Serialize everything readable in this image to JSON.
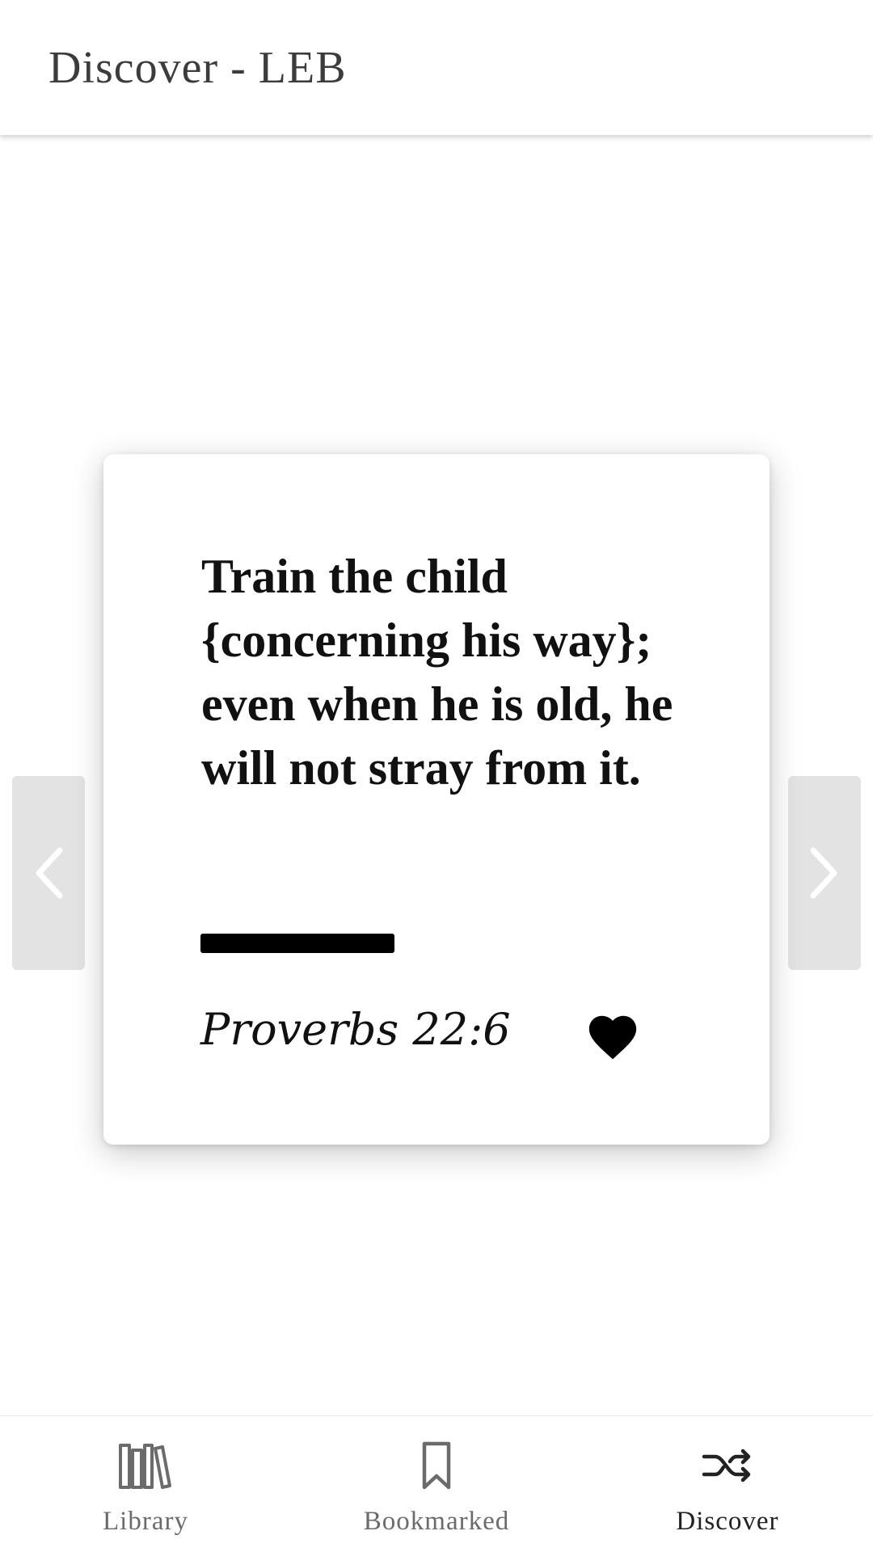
{
  "header": {
    "title": "Discover - LEB"
  },
  "card": {
    "verse_text": "Train the child {concerning his way}; even when he is old, he will not stray from it.",
    "reference": "Proverbs 22:6",
    "favorited": true,
    "favorite_icon": "heart-icon"
  },
  "navigation": {
    "prev_icon": "chevron-left-icon",
    "next_icon": "chevron-right-icon"
  },
  "bottom_nav": {
    "items": [
      {
        "label": "Library",
        "icon": "books-icon",
        "active": false
      },
      {
        "label": "Bookmarked",
        "icon": "bookmark-icon",
        "active": false
      },
      {
        "label": "Discover",
        "icon": "shuffle-icon",
        "active": true
      }
    ]
  },
  "colors": {
    "text": "#111111",
    "header_text": "#3c3c3c",
    "inactive_tab": "#6b6b6b",
    "arrow_bg": "#e3e3e3"
  }
}
